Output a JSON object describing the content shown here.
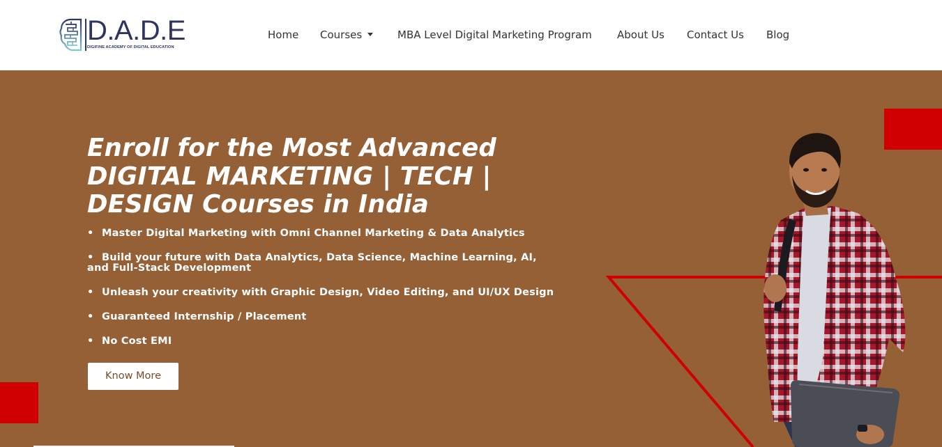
{
  "header": {
    "logo": {
      "wordmark": "D.A.D.E",
      "tagline": "DIGIFINE ACADEMY OF DIGITAL EDUCATION"
    },
    "nav": [
      {
        "label": "Home"
      },
      {
        "label": "Courses",
        "has_dropdown": true
      },
      {
        "label": "MBA Level Digital Marketing Program"
      },
      {
        "label": "About Us"
      },
      {
        "label": "Contact Us"
      },
      {
        "label": "Blog"
      }
    ]
  },
  "hero": {
    "headline_lines": [
      "Enroll for the Most Advanced",
      "DIGITAL MARKETING | TECH |",
      "DESIGN Courses in India"
    ],
    "bullets": [
      "Master Digital Marketing with Omni Channel Marketing & Data Analytics",
      "Build your future with Data Analytics, Data Science, Machine Learning, AI, and Full-Stack Development",
      "Unleash your creativity with Graphic Design, Video Editing, and UI/UX Design",
      "Guaranteed Internship / Placement",
      "No Cost EMI"
    ],
    "bullet_glyph": "•",
    "cta_label": "Know More"
  },
  "colors": {
    "hero_background": "#956036",
    "accent_red": "#d10000",
    "logo_navy": "#2f3560",
    "nav_text": "#333333",
    "cta_text": "#7a4a26"
  },
  "icons": {
    "logo_mark": "brain-maze-icon",
    "dropdown": "caret-down-icon"
  }
}
